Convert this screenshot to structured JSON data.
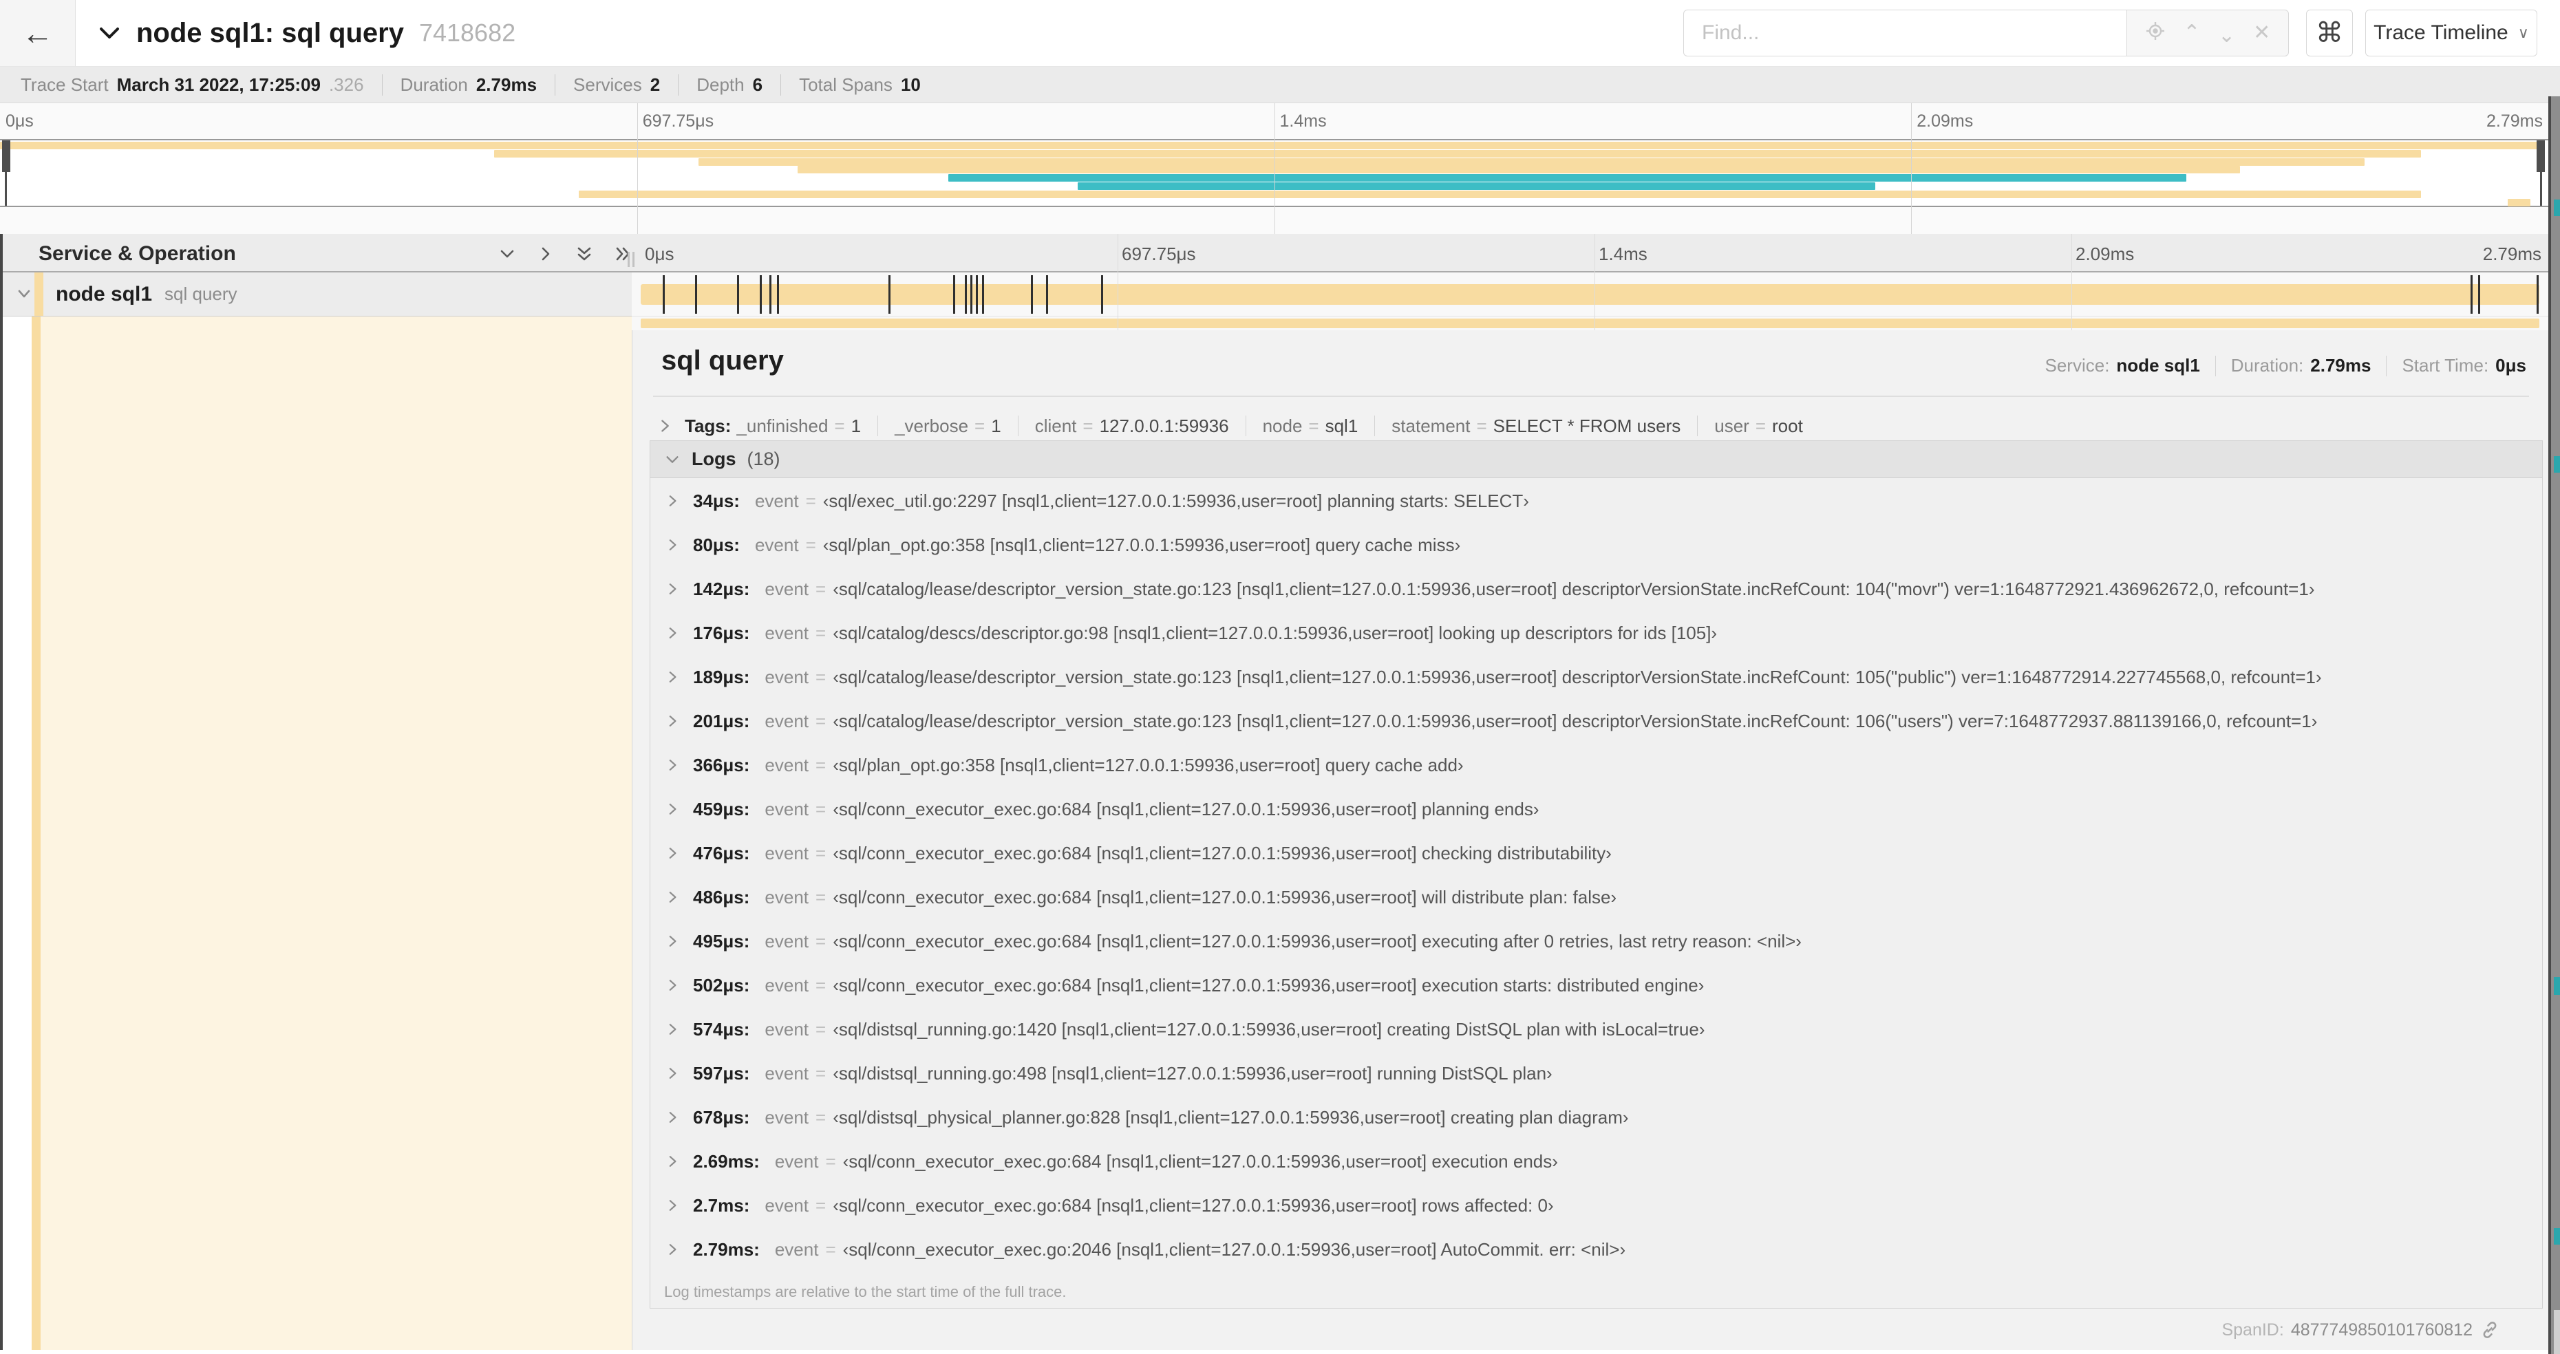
{
  "colors": {
    "tan": "#f8dca1",
    "teal": "#3dbdc5",
    "cream": "#fdf4e1",
    "marker": "#2f2f2f"
  },
  "header": {
    "back_arrow": "←",
    "title": "node sql1: sql query",
    "trace_id_short": "7418682",
    "find_placeholder": "Find...",
    "keyboard_button": "⌘",
    "view_button": "Trace Timeline"
  },
  "trace_summary": [
    {
      "label": "Trace Start",
      "value": "March 31 2022, 17:25:09",
      "suffix": ".326"
    },
    {
      "label": "Duration",
      "value": "2.79ms",
      "suffix": ""
    },
    {
      "label": "Services",
      "value": "2",
      "suffix": ""
    },
    {
      "label": "Depth",
      "value": "6",
      "suffix": ""
    },
    {
      "label": "Total Spans",
      "value": "10",
      "suffix": ""
    }
  ],
  "timeline": {
    "ticks": [
      "0μs",
      "697.75μs",
      "1.4ms",
      "2.09ms",
      "2.79ms"
    ],
    "left_header": "Service & Operation",
    "row": {
      "service": "node sql1",
      "operation": "sql query"
    },
    "log_marker_pcts": [
      1.2,
      2.9,
      5.1,
      6.3,
      6.8,
      7.2,
      13.1,
      16.5,
      17.1,
      17.4,
      17.7,
      18.0,
      20.6,
      21.4,
      24.3,
      96.4,
      96.8,
      99.9
    ]
  },
  "minimap": {
    "spans": [
      {
        "color": "tan",
        "start": 0,
        "end": 99.7,
        "row": 0
      },
      {
        "color": "tan",
        "start": 19.4,
        "end": 95.0,
        "row": 1
      },
      {
        "color": "tan",
        "start": 27.4,
        "end": 92.8,
        "row": 2
      },
      {
        "color": "tan",
        "start": 31.3,
        "end": 87.9,
        "row": 3
      },
      {
        "color": "teal",
        "start": 37.2,
        "end": 85.8,
        "row": 4
      },
      {
        "color": "teal",
        "start": 42.3,
        "end": 73.6,
        "row": 5
      },
      {
        "color": "tan",
        "start": 22.7,
        "end": 95.0,
        "row": 6
      },
      {
        "color": "tan",
        "start": 98.4,
        "end": 99.3,
        "row": 7
      }
    ]
  },
  "detail": {
    "title": "sql query",
    "meta": [
      {
        "label": "Service:",
        "value": "node sql1"
      },
      {
        "label": "Duration:",
        "value": "2.79ms"
      },
      {
        "label": "Start Time:",
        "value": "0μs"
      }
    ],
    "tags_label": "Tags:",
    "tags": [
      {
        "key": "_unfinished",
        "value": "1"
      },
      {
        "key": "_verbose",
        "value": "1"
      },
      {
        "key": "client",
        "value": "127.0.0.1:59936"
      },
      {
        "key": "node",
        "value": "sql1"
      },
      {
        "key": "statement",
        "value": "SELECT * FROM users"
      },
      {
        "key": "user",
        "value": "root"
      }
    ],
    "logs_label": "Logs",
    "logs_count": "(18)",
    "logs": [
      {
        "time": "34μs:",
        "field": "event",
        "value": "‹sql/exec_util.go:2297 [nsql1,client=127.0.0.1:59936,user=root] planning starts: SELECT›"
      },
      {
        "time": "80μs:",
        "field": "event",
        "value": "‹sql/plan_opt.go:358 [nsql1,client=127.0.0.1:59936,user=root] query cache miss›"
      },
      {
        "time": "142μs:",
        "field": "event",
        "value": "‹sql/catalog/lease/descriptor_version_state.go:123 [nsql1,client=127.0.0.1:59936,user=root] descriptorVersionState.incRefCount: 104(\"movr\") ver=1:1648772921.436962672,0, refcount=1›"
      },
      {
        "time": "176μs:",
        "field": "event",
        "value": "‹sql/catalog/descs/descriptor.go:98 [nsql1,client=127.0.0.1:59936,user=root] looking up descriptors for ids [105]›"
      },
      {
        "time": "189μs:",
        "field": "event",
        "value": "‹sql/catalog/lease/descriptor_version_state.go:123 [nsql1,client=127.0.0.1:59936,user=root] descriptorVersionState.incRefCount: 105(\"public\") ver=1:1648772914.227745568,0, refcount=1›"
      },
      {
        "time": "201μs:",
        "field": "event",
        "value": "‹sql/catalog/lease/descriptor_version_state.go:123 [nsql1,client=127.0.0.1:59936,user=root] descriptorVersionState.incRefCount: 106(\"users\") ver=7:1648772937.881139166,0, refcount=1›"
      },
      {
        "time": "366μs:",
        "field": "event",
        "value": "‹sql/plan_opt.go:358 [nsql1,client=127.0.0.1:59936,user=root] query cache add›"
      },
      {
        "time": "459μs:",
        "field": "event",
        "value": "‹sql/conn_executor_exec.go:684 [nsql1,client=127.0.0.1:59936,user=root] planning ends›"
      },
      {
        "time": "476μs:",
        "field": "event",
        "value": "‹sql/conn_executor_exec.go:684 [nsql1,client=127.0.0.1:59936,user=root] checking distributability›"
      },
      {
        "time": "486μs:",
        "field": "event",
        "value": "‹sql/conn_executor_exec.go:684 [nsql1,client=127.0.0.1:59936,user=root] will distribute plan: false›"
      },
      {
        "time": "495μs:",
        "field": "event",
        "value": "‹sql/conn_executor_exec.go:684 [nsql1,client=127.0.0.1:59936,user=root] executing after 0 retries, last retry reason: <nil>›"
      },
      {
        "time": "502μs:",
        "field": "event",
        "value": "‹sql/conn_executor_exec.go:684 [nsql1,client=127.0.0.1:59936,user=root] execution starts: distributed engine›"
      },
      {
        "time": "574μs:",
        "field": "event",
        "value": "‹sql/distsql_running.go:1420 [nsql1,client=127.0.0.1:59936,user=root] creating DistSQL plan with isLocal=true›"
      },
      {
        "time": "597μs:",
        "field": "event",
        "value": "‹sql/distsql_running.go:498 [nsql1,client=127.0.0.1:59936,user=root] running DistSQL plan›"
      },
      {
        "time": "678μs:",
        "field": "event",
        "value": "‹sql/distsql_physical_planner.go:828 [nsql1,client=127.0.0.1:59936,user=root] creating plan diagram›"
      },
      {
        "time": "2.69ms:",
        "field": "event",
        "value": "‹sql/conn_executor_exec.go:684 [nsql1,client=127.0.0.1:59936,user=root] execution ends›"
      },
      {
        "time": "2.7ms:",
        "field": "event",
        "value": "‹sql/conn_executor_exec.go:684 [nsql1,client=127.0.0.1:59936,user=root] rows affected: 0›"
      },
      {
        "time": "2.79ms:",
        "field": "event",
        "value": "‹sql/conn_executor_exec.go:2046 [nsql1,client=127.0.0.1:59936,user=root] AutoCommit. err: <nil>›"
      }
    ],
    "footer_note": "Log timestamps are relative to the start time of the full trace.",
    "span_id_label": "SpanID:",
    "span_id": "4877749850101760812"
  }
}
